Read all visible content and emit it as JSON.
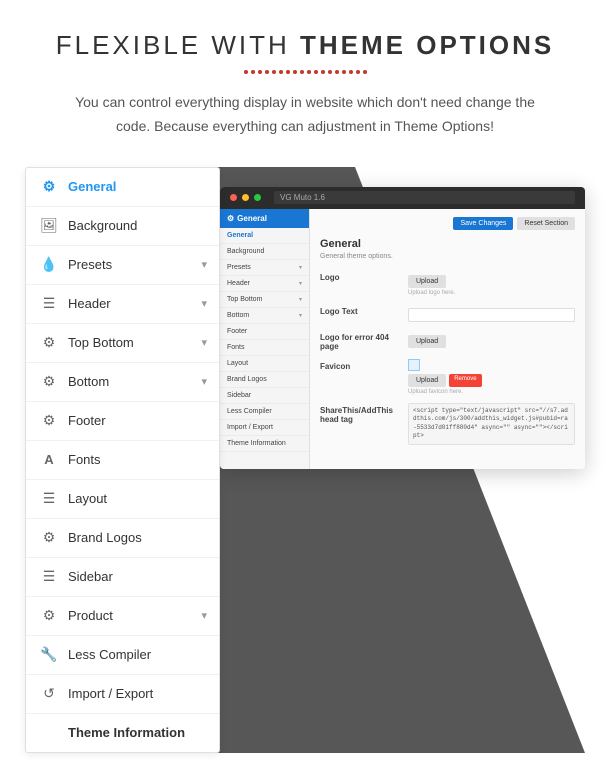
{
  "headline": {
    "prefix": "FLEXIBLE WITH ",
    "bold": "THEME OPTIONS"
  },
  "subtitle": "You can control everything display in website which don't need change the code. Because everything can adjustment in Theme Options!",
  "dots": 18,
  "sidebar": {
    "items": [
      {
        "id": "general",
        "label": "General",
        "icon": "⚙",
        "active": true,
        "chevron": false,
        "bold": true
      },
      {
        "id": "background",
        "label": "Background",
        "icon": "🖼",
        "active": false,
        "chevron": false
      },
      {
        "id": "presets",
        "label": "Presets",
        "icon": "💧",
        "active": false,
        "chevron": true
      },
      {
        "id": "header",
        "label": "Header",
        "icon": "☰",
        "active": false,
        "chevron": true
      },
      {
        "id": "top-bottom",
        "label": "Top Bottom",
        "icon": "⚙",
        "active": false,
        "chevron": true
      },
      {
        "id": "bottom",
        "label": "Bottom",
        "icon": "⚙",
        "active": false,
        "chevron": true
      },
      {
        "id": "footer",
        "label": "Footer",
        "icon": "⚙",
        "active": false,
        "chevron": false
      },
      {
        "id": "fonts",
        "label": "Fonts",
        "icon": "A",
        "active": false,
        "chevron": false
      },
      {
        "id": "layout",
        "label": "Layout",
        "icon": "☰",
        "active": false,
        "chevron": false
      },
      {
        "id": "brand-logos",
        "label": "Brand Logos",
        "icon": "⚙",
        "active": false,
        "chevron": false
      },
      {
        "id": "sidebar",
        "label": "Sidebar",
        "icon": "☰",
        "active": false,
        "chevron": false
      },
      {
        "id": "product",
        "label": "Product",
        "icon": "⚙",
        "active": false,
        "chevron": true
      },
      {
        "id": "less-compiler",
        "label": "Less Compiler",
        "icon": "🔧",
        "active": false,
        "chevron": false
      },
      {
        "id": "import-export",
        "label": "Import / Export",
        "icon": "↺",
        "active": false,
        "chevron": false
      },
      {
        "id": "theme-info",
        "label": "Theme Information",
        "icon": "",
        "active": false,
        "chevron": false,
        "bold": true
      }
    ]
  },
  "browser": {
    "url": "VG Muto 1.6",
    "topbar_buttons": {
      "save": "Save Changes",
      "reset": "Reset Section"
    },
    "section_title": "General",
    "section_sub": "General theme options.",
    "fields": [
      {
        "label": "Logo",
        "type": "upload",
        "upload_label": "Upload",
        "note": "Upload logo here."
      },
      {
        "label": "Logo Text",
        "type": "text",
        "value": ""
      },
      {
        "label": "Logo for error 404 page",
        "type": "upload",
        "upload_label": "Upload",
        "note": ""
      },
      {
        "label": "Favicon",
        "type": "favicon",
        "upload_label": "Upload",
        "remove_label": "Remove",
        "note": "Upload favicon here."
      },
      {
        "label": "ShareThis/AddThis head tag",
        "type": "code",
        "value": "<script type=\"text/javascript\" src=\"//s7.addthis.com/js/300/addthis_widget.js#pubid=ra-5533d7d01ff880d4\" async=\"\" async=\"\"><\\/script>"
      }
    ],
    "bc_sidebar_items": [
      {
        "label": "General",
        "active": true
      },
      {
        "label": "Background",
        "active": false
      },
      {
        "label": "Presets",
        "active": false,
        "chevron": true
      },
      {
        "label": "Header",
        "active": false,
        "chevron": true
      },
      {
        "label": "Top Bottom",
        "active": false,
        "chevron": true
      },
      {
        "label": "Bottom",
        "active": false,
        "chevron": true
      },
      {
        "label": "Footer",
        "active": false
      },
      {
        "label": "Fonts",
        "active": false
      },
      {
        "label": "Layout",
        "active": false
      },
      {
        "label": "Brand Logos",
        "active": false
      },
      {
        "label": "Sidebar",
        "active": false
      },
      {
        "label": "Less Compiler",
        "active": false
      },
      {
        "label": "Import / Export",
        "active": false
      },
      {
        "label": "Theme Information",
        "active": false
      }
    ]
  }
}
